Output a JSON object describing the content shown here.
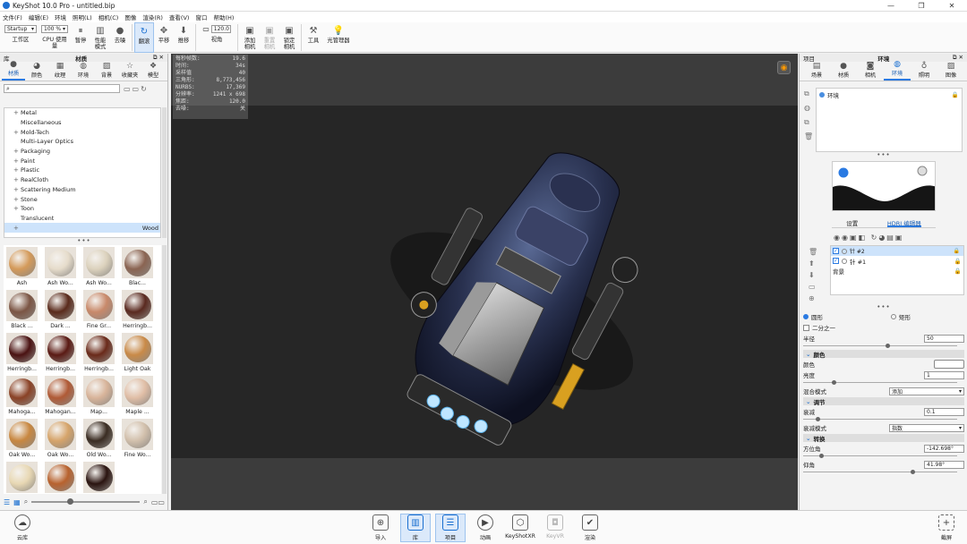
{
  "window": {
    "title": "KeyShot 10.0 Pro  - untitled.bip",
    "min": "—",
    "max": "❐",
    "close": "✕"
  },
  "menu": [
    "文件(F)",
    "编辑(E)",
    "环境",
    "照明(L)",
    "相机(C)",
    "图像",
    "渲染(R)",
    "查看(V)",
    "窗口",
    "帮助(H)"
  ],
  "toolbar": {
    "workspace_value": "Startup",
    "workspace_label": "工作区",
    "cpu_value": "100 %",
    "cpu_label": "CPU 使用量",
    "pause": "暂停",
    "perf": "性能\n模式",
    "denoise": "去噪",
    "refresh": "翻滚",
    "pan": "平移",
    "dolly": "推移",
    "fov_value": "120.0",
    "fov_label": "视角",
    "add_camera": "添加\n相机",
    "reset_camera": "重置\n相机",
    "lock_camera": "锁定\n相机",
    "tools": "工具",
    "light_manager": "光管理器"
  },
  "left": {
    "header": "库",
    "title": "材质",
    "tabs": [
      "材质",
      "颜色",
      "纹理",
      "环境",
      "背景",
      "收藏夹",
      "模型"
    ],
    "tree": [
      {
        "label": "Metal",
        "exp": "+"
      },
      {
        "label": "Miscellaneous",
        "exp": ""
      },
      {
        "label": "Mold-Tech",
        "exp": "+"
      },
      {
        "label": "Multi-Layer Optics",
        "exp": ""
      },
      {
        "label": "Packaging",
        "exp": "+"
      },
      {
        "label": "Paint",
        "exp": "+"
      },
      {
        "label": "Plastic",
        "exp": "+"
      },
      {
        "label": "RealCloth",
        "exp": "+"
      },
      {
        "label": "Scattering Medium",
        "exp": "+"
      },
      {
        "label": "Stone",
        "exp": "+"
      },
      {
        "label": "Toon",
        "exp": "+"
      },
      {
        "label": "Translucent",
        "exp": ""
      },
      {
        "label": "Wood",
        "exp": "+",
        "selected": true
      }
    ],
    "materials": [
      {
        "name": "Ash",
        "color": "#d49a5a"
      },
      {
        "name": "Ash Wo...",
        "color": "#e6dccb"
      },
      {
        "name": "Ash Wo...",
        "color": "#dcd2bd"
      },
      {
        "name": "Blac...",
        "color": "#8a6452"
      },
      {
        "name": "Black ...",
        "color": "#7b5544"
      },
      {
        "name": "Dark ...",
        "color": "#5a2b1c"
      },
      {
        "name": "Fine Gr...",
        "color": "#c8896a"
      },
      {
        "name": "Herringb...",
        "color": "#5a2a20"
      },
      {
        "name": "Herringb...",
        "color": "#4a1212"
      },
      {
        "name": "Herringb...",
        "color": "#5a1a14"
      },
      {
        "name": "Herringb...",
        "color": "#6a2a1a"
      },
      {
        "name": "Light Oak",
        "color": "#c98a48"
      },
      {
        "name": "Mahoga...",
        "color": "#8a4226"
      },
      {
        "name": "Mahogan...",
        "color": "#b05a36"
      },
      {
        "name": "Map...",
        "color": "#d8b49a"
      },
      {
        "name": "Maple ...",
        "color": "#e0bea6"
      },
      {
        "name": "Oak Wo...",
        "color": "#c88740"
      },
      {
        "name": "Oak Wo...",
        "color": "#d6a46a"
      },
      {
        "name": "Old Wo...",
        "color": "#3a2c22"
      },
      {
        "name": "Fine Wo...",
        "color": "#d2c0ac"
      },
      {
        "name": "",
        "color": "#e8d8b4"
      },
      {
        "name": "",
        "color": "#b8622e"
      },
      {
        "name": "",
        "color": "#2a1410"
      }
    ]
  },
  "hud": [
    [
      "每秒帧数:",
      "19.6"
    ],
    [
      "时间:",
      "34s"
    ],
    [
      "采样值",
      "40"
    ],
    [
      "三角形:",
      "8,773,456"
    ],
    [
      "NURBS:",
      "17,369"
    ],
    [
      "分辨率:",
      "1241 x 698"
    ],
    [
      "焦距:",
      "120.0"
    ],
    [
      "去噪:",
      "关"
    ]
  ],
  "right": {
    "header": "项目",
    "title": "环境",
    "tabs": [
      "场景",
      "材质",
      "相机",
      "环境",
      "照明",
      "图像"
    ],
    "env_item": "环境",
    "subtab_settings": "设置",
    "subtab_editor": "HDRI 编辑器",
    "pins": [
      {
        "label": "针 #2",
        "selected": true
      },
      {
        "label": "针 #1",
        "selected": false
      },
      {
        "label": "背景",
        "selected": false
      }
    ],
    "shape_circle": "圆形",
    "shape_rect": "矩形",
    "half": "二分之一",
    "radius_label": "半径",
    "radius_value": "50",
    "sec_color": "颜色",
    "color_label": "颜色",
    "brightness_label": "亮度",
    "brightness_value": "1",
    "blend_label": "混合模式",
    "blend_value": "添加",
    "sec_adjust": "调节",
    "falloff_label": "衰减",
    "falloff_value": "0.1",
    "falloff_mode_label": "衰减模式",
    "falloff_mode_value": "指数",
    "sec_transform": "转换",
    "azimuth_label": "方位角",
    "azimuth_value": "-142.698°",
    "elev_label": "仰角",
    "elev_value": "41.98°"
  },
  "bottom": {
    "cloud": "云库",
    "import": "导入",
    "library": "库",
    "project": "项目",
    "animation": "动画",
    "keyshotxr": "KeyShotXR",
    "keyvr": "KeyVR",
    "render": "渲染",
    "screenshot": "截屏"
  }
}
